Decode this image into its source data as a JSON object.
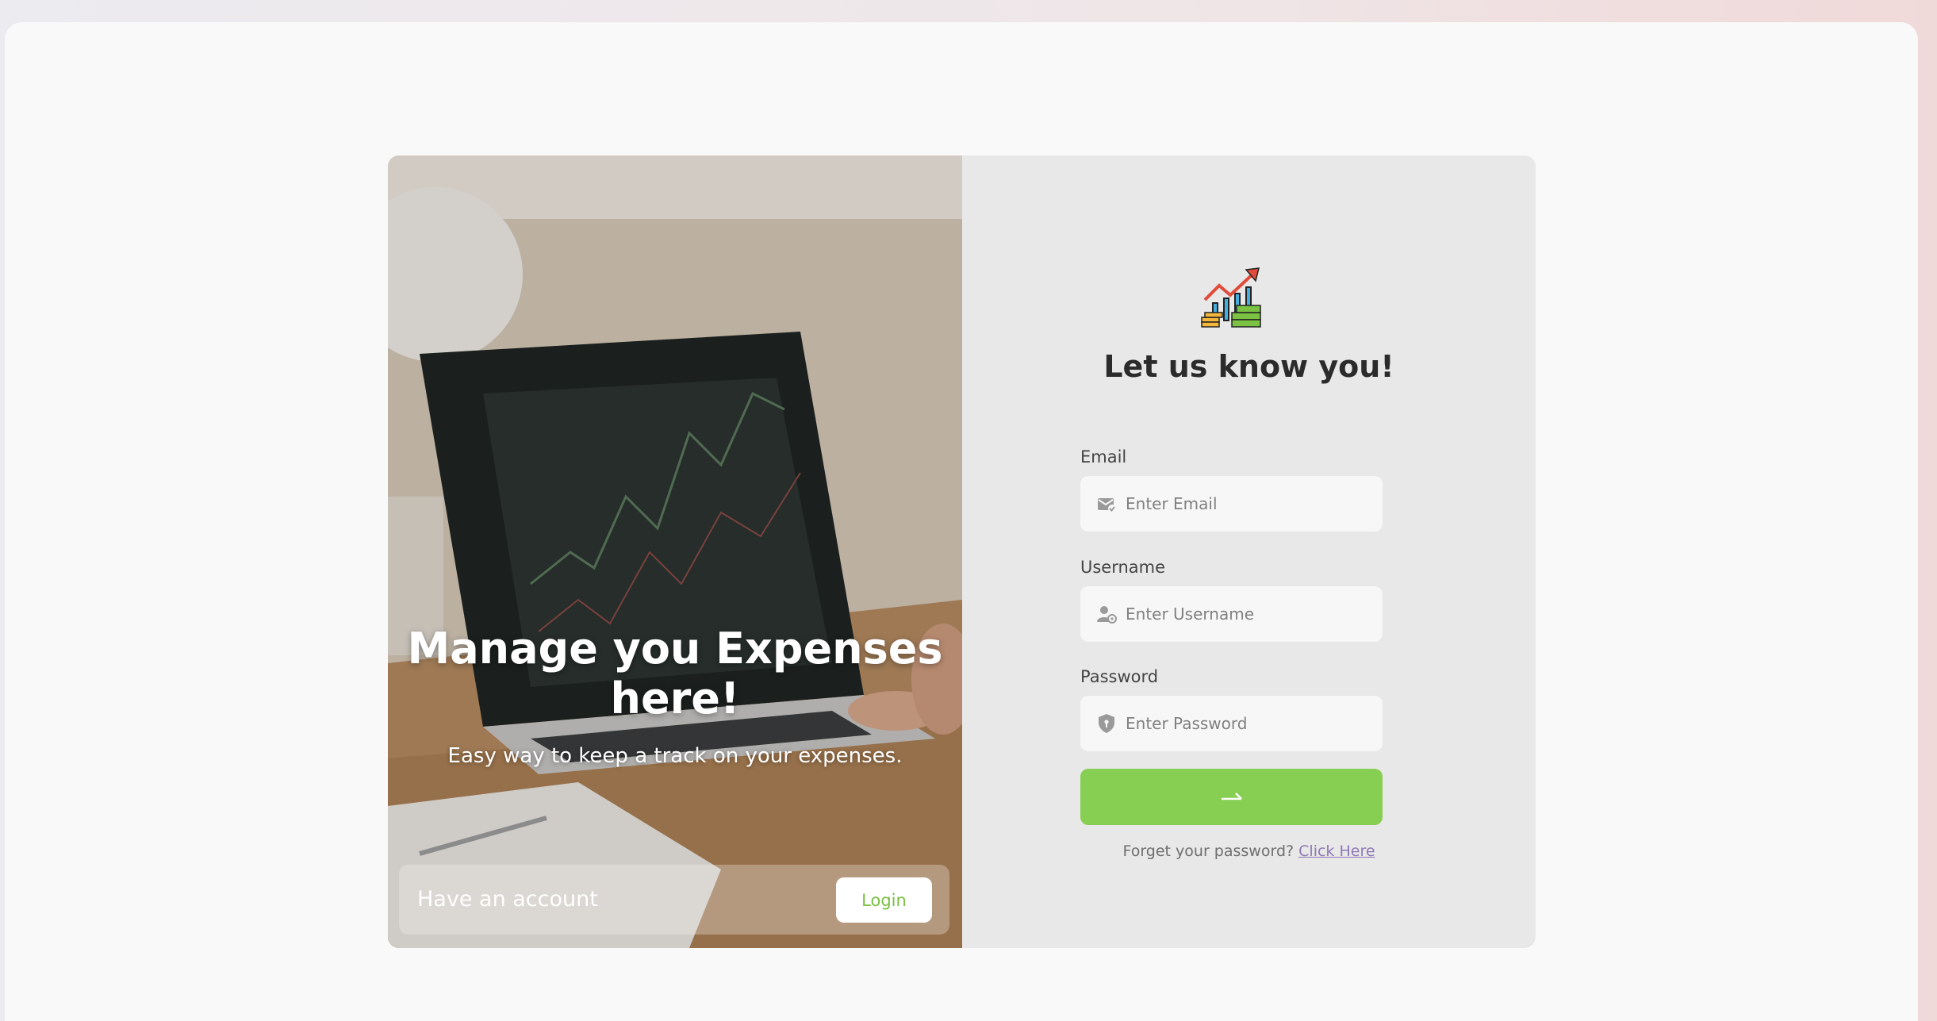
{
  "hero": {
    "title": "Manage you Expenses here!",
    "subtitle": "Easy way to keep a track on your expenses.",
    "account_prompt": "Have an account",
    "login_label": "Login"
  },
  "form": {
    "title": "Let us know you!",
    "email": {
      "label": "Email",
      "placeholder": "Enter Email",
      "icon": "email-icon"
    },
    "username": {
      "label": "Username",
      "placeholder": "Enter Username",
      "icon": "user-icon"
    },
    "password": {
      "label": "Password",
      "placeholder": "Enter Password",
      "icon": "shield-icon"
    },
    "submit_icon": "arrow-right-icon",
    "forgot_text": "Forget your password?",
    "forgot_link": "Click Here"
  },
  "colors": {
    "accent_green": "#86cf53",
    "login_text_green": "#7ac143",
    "link_purple": "#8f78b5",
    "panel_bg": "#e8e8e8"
  }
}
